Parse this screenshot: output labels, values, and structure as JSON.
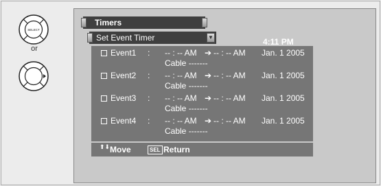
{
  "remotes": {
    "select_button_label": "SELECT",
    "or_text": "or",
    "right_button_icon": "right-triangle"
  },
  "tabs": {
    "timers": "Timers",
    "set_event_timer": "Set Event Timer"
  },
  "clock": "4:11 PM",
  "events": [
    {
      "name": "Event1",
      "colon": ":",
      "start": "-- : -- AM",
      "arrow": "➔",
      "end": "-- : -- AM",
      "date": "Jan. 1 2005",
      "source": "Cable  -------"
    },
    {
      "name": "Event2",
      "colon": ":",
      "start": "-- : -- AM",
      "arrow": "➔",
      "end": "-- : -- AM",
      "date": "Jan. 1 2005",
      "source": "Cable  -------"
    },
    {
      "name": "Event3",
      "colon": ":",
      "start": "-- : -- AM",
      "arrow": "➔",
      "end": "-- : -- AM",
      "date": "Jan. 1 2005",
      "source": "Cable  -------"
    },
    {
      "name": "Event4",
      "colon": ":",
      "start": "-- : -- AM",
      "arrow": "➔",
      "end": "-- : -- AM",
      "date": "Jan. 1 2005",
      "source": "Cable  -------"
    }
  ],
  "footer": {
    "updown_icon": "⬆⬇",
    "move_label": "Move",
    "sel_badge": "SEL",
    "return_label": "Return"
  }
}
